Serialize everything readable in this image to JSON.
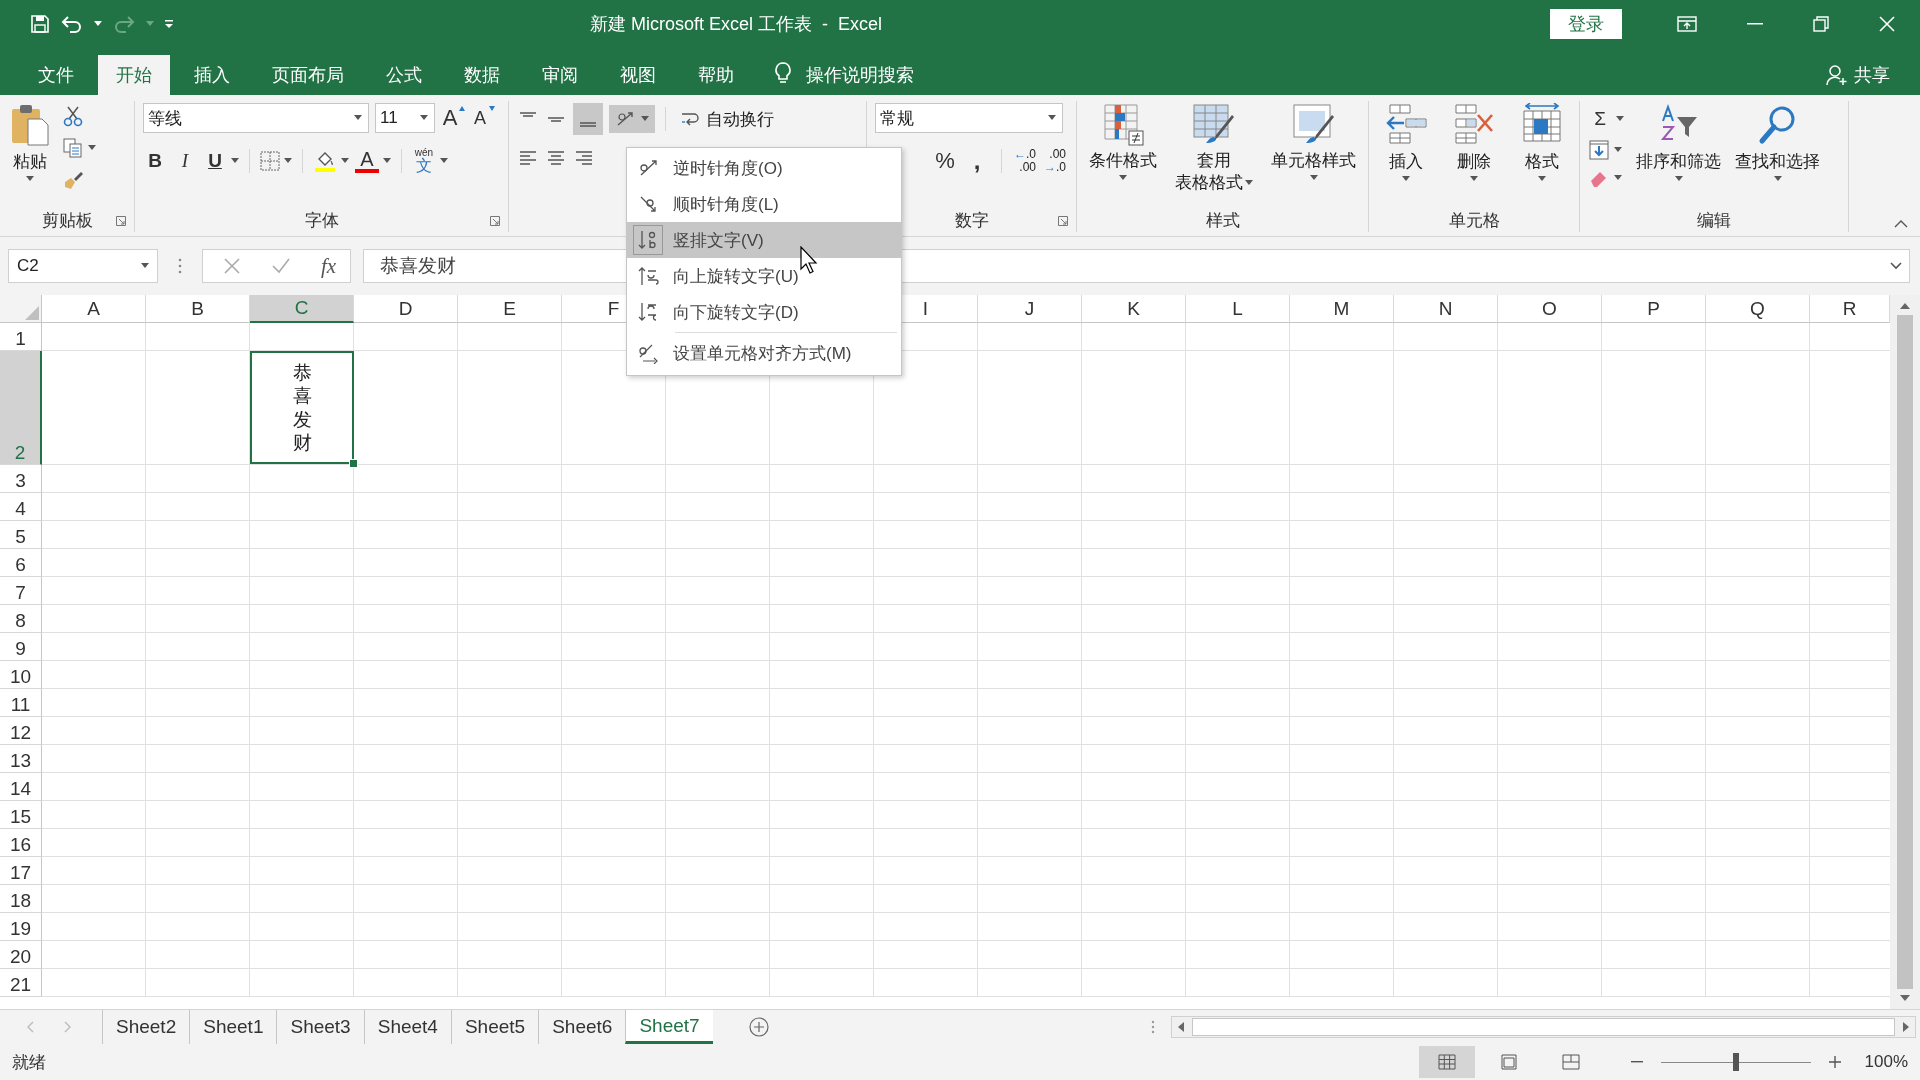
{
  "title_bar": {
    "title": "新建 Microsoft Excel 工作表  -  Excel",
    "login_button": "登录"
  },
  "tabs": [
    {
      "label": "文件",
      "selected": false
    },
    {
      "label": "开始",
      "selected": true
    },
    {
      "label": "插入",
      "selected": false
    },
    {
      "label": "页面布局",
      "selected": false
    },
    {
      "label": "公式",
      "selected": false
    },
    {
      "label": "数据",
      "selected": false
    },
    {
      "label": "审阅",
      "selected": false
    },
    {
      "label": "视图",
      "selected": false
    },
    {
      "label": "帮助",
      "selected": false
    }
  ],
  "tell_me": "操作说明搜索",
  "share": "共享",
  "ribbon": {
    "clipboard": {
      "paste": "粘贴",
      "label": "剪贴板"
    },
    "font": {
      "font_name": "等线",
      "font_size": "11",
      "grow": "A",
      "shrink": "A",
      "bold": "B",
      "italic": "I",
      "underline": "U",
      "font_color": "A",
      "phonetic_top": "wén",
      "phonetic_bottom": "文",
      "label": "字体"
    },
    "alignment": {
      "wrap_text": "自动换行",
      "orientation_open": true
    },
    "number": {
      "format": "常规",
      "percent": "%",
      "comma": ",",
      "increase_decimal": {
        "arrow": "←",
        "top": ".0",
        "bottom": ".00"
      },
      "decrease_decimal": {
        "arrow": "→",
        "top": ".00",
        "bottom": ".0"
      },
      "label": "数字"
    },
    "styles": {
      "buttons": [
        {
          "kind": "conditional",
          "lines": [
            "条件格式"
          ]
        },
        {
          "kind": "table",
          "lines": [
            "套用",
            "表格格式"
          ]
        },
        {
          "kind": "cellstyle",
          "lines": [
            "单元格样式"
          ]
        }
      ],
      "label": "样式"
    },
    "cells": {
      "buttons": [
        {
          "kind": "insert",
          "label": "插入"
        },
        {
          "kind": "delete",
          "label": "删除"
        },
        {
          "kind": "format",
          "label": "格式"
        }
      ],
      "label": "单元格"
    },
    "editing": {
      "sum": "Σ",
      "sort": "排序和筛选",
      "find": "查找和选择",
      "label": "编辑"
    }
  },
  "formula_bar": {
    "name_box": "C2",
    "fx": "fx",
    "value": "恭喜发财"
  },
  "orientation_menu": [
    {
      "kind": "ccw",
      "label": "逆时针角度(O)",
      "selected": false
    },
    {
      "kind": "cw",
      "label": "顺时针角度(L)",
      "selected": false
    },
    {
      "kind": "vertical",
      "label": "竖排文字(V)",
      "selected": true
    },
    {
      "kind": "up",
      "label": "向上旋转文字(U)",
      "selected": false
    },
    {
      "kind": "down",
      "label": "向下旋转文字(D)",
      "selected": false
    },
    {
      "kind": "format",
      "label": "设置单元格对齐方式(M)",
      "selected": false
    }
  ],
  "sheet": {
    "columns": [
      {
        "label": "A",
        "selected": false
      },
      {
        "label": "B",
        "selected": false
      },
      {
        "label": "C",
        "selected": true
      },
      {
        "label": "D",
        "selected": false
      },
      {
        "label": "E",
        "selected": false
      },
      {
        "label": "F",
        "selected": false
      },
      null,
      null,
      {
        "label": "I",
        "selected": false
      },
      {
        "label": "J",
        "selected": false
      },
      {
        "label": "K",
        "selected": false
      },
      {
        "label": "L",
        "selected": false
      },
      {
        "label": "M",
        "selected": false
      },
      {
        "label": "N",
        "selected": false
      },
      {
        "label": "O",
        "selected": false
      },
      {
        "label": "P",
        "selected": false
      },
      {
        "label": "Q",
        "selected": false
      },
      {
        "label": "R",
        "selected": false
      }
    ],
    "rows": [
      {
        "label": "1",
        "selected": false
      },
      {
        "label": "2",
        "selected": true,
        "cells": [
          null,
          null,
          {
            "text": "恭喜发财",
            "vertical": true,
            "active": true
          }
        ]
      },
      {
        "label": "3",
        "selected": false
      },
      {
        "label": "4",
        "selected": false
      },
      {
        "label": "5",
        "selected": false
      },
      {
        "label": "6",
        "selected": false
      },
      {
        "label": "7",
        "selected": false
      },
      {
        "label": "8",
        "selected": false
      },
      {
        "label": "9",
        "selected": false
      },
      {
        "label": "10",
        "selected": false
      },
      {
        "label": "11",
        "selected": false
      },
      {
        "label": "12",
        "selected": false
      },
      {
        "label": "13",
        "selected": false
      },
      {
        "label": "14",
        "selected": false
      },
      {
        "label": "15",
        "selected": false
      },
      {
        "label": "16",
        "selected": false
      },
      {
        "label": "17",
        "selected": false
      },
      {
        "label": "18",
        "selected": false
      },
      {
        "label": "19",
        "selected": false
      },
      {
        "label": "20",
        "selected": false
      },
      {
        "label": "21",
        "selected": false
      }
    ]
  },
  "sheet_tabs": [
    {
      "label": "Sheet2",
      "selected": false
    },
    {
      "label": "Sheet1",
      "selected": false
    },
    {
      "label": "Sheet3",
      "selected": false
    },
    {
      "label": "Sheet4",
      "selected": false
    },
    {
      "label": "Sheet5",
      "selected": false
    },
    {
      "label": "Sheet6",
      "selected": false
    },
    {
      "label": "Sheet7",
      "selected": true
    }
  ],
  "status_bar": {
    "status": "就绪",
    "views": [
      {
        "kind": "normal",
        "selected": true
      },
      {
        "kind": "layout",
        "selected": false
      },
      {
        "kind": "pagebreak",
        "selected": false
      }
    ],
    "zoom_slider": {
      "level": 0.5
    },
    "zoom": "100%"
  }
}
